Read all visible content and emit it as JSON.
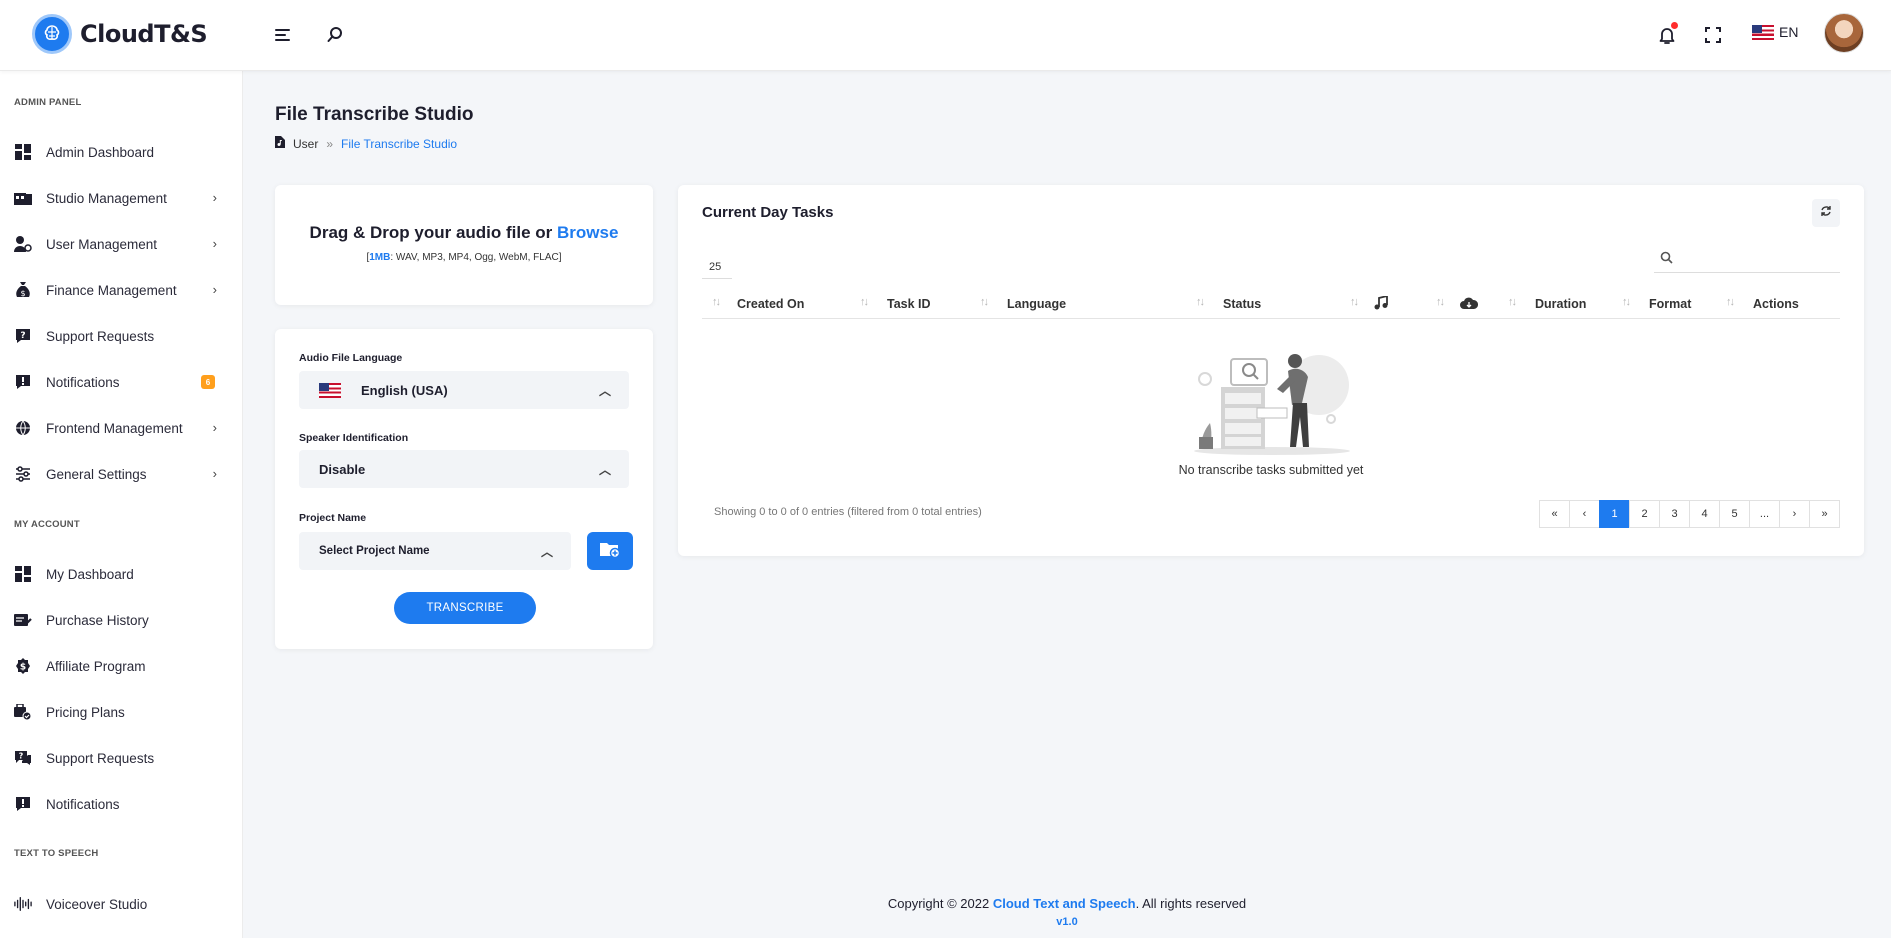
{
  "brand": {
    "name": "CloudT&S"
  },
  "header": {
    "language": "EN",
    "icons": [
      "menu-icon",
      "search-icon",
      "bell-icon",
      "fullscreen-icon",
      "us-flag-icon",
      "avatar"
    ]
  },
  "sidebar": {
    "sections": {
      "admin": "ADMIN PANEL",
      "account": "MY ACCOUNT",
      "tts": "TEXT TO SPEECH"
    },
    "admin_items": [
      {
        "label": "Admin Dashboard"
      },
      {
        "label": "Studio Management"
      },
      {
        "label": "User Management"
      },
      {
        "label": "Finance Management"
      },
      {
        "label": "Support Requests"
      },
      {
        "label": "Notifications",
        "badge": "6"
      },
      {
        "label": "Frontend Management"
      },
      {
        "label": "General Settings"
      }
    ],
    "account_items": [
      {
        "label": "My Dashboard"
      },
      {
        "label": "Purchase History"
      },
      {
        "label": "Affiliate Program"
      },
      {
        "label": "Pricing Plans"
      },
      {
        "label": "Support Requests"
      },
      {
        "label": "Notifications"
      }
    ],
    "tts_items": [
      {
        "label": "Voiceover Studio"
      }
    ]
  },
  "page": {
    "title": "File Transcribe Studio",
    "breadcrumb": {
      "root": "User",
      "sep": "»",
      "current": "File Transcribe Studio"
    }
  },
  "upload": {
    "title_main": "Drag & Drop your audio file or ",
    "title_link": "Browse",
    "limit": "1MB",
    "formats": ": WAV, MP3, MP4, Ogg, WebM, FLAC",
    "bracket_open": "[",
    "bracket_close": "]"
  },
  "form": {
    "language_label": "Audio File Language",
    "language_value": "English (USA)",
    "speaker_label": "Speaker Identification",
    "speaker_value": "Disable",
    "project_label": "Project Name",
    "project_value": "Select Project Name",
    "submit": "TRANSCRIBE"
  },
  "tasks": {
    "title": "Current Day Tasks",
    "page_length": "25",
    "columns": [
      "Created On",
      "Task ID",
      "Language",
      "Status",
      "",
      "",
      "Duration",
      "Format",
      "Actions"
    ],
    "empty": "No transcribe tasks submitted yet",
    "info": "Showing 0 to 0 of 0 entries (filtered from 0 total entries)",
    "pages": [
      "«",
      "‹",
      "1",
      "2",
      "3",
      "4",
      "5",
      "...",
      "›",
      "»"
    ],
    "active_page": "1"
  },
  "footer": {
    "prefix": "Copyright © 2022 ",
    "brand": "Cloud Text and Speech",
    "suffix": ". All rights reserved",
    "version": "v1.0"
  },
  "colors": {
    "accent": "#1e7bef",
    "badge": "#ff9f1c",
    "notification_dot": "#ff2d2d",
    "background": "#f4f6f9"
  }
}
